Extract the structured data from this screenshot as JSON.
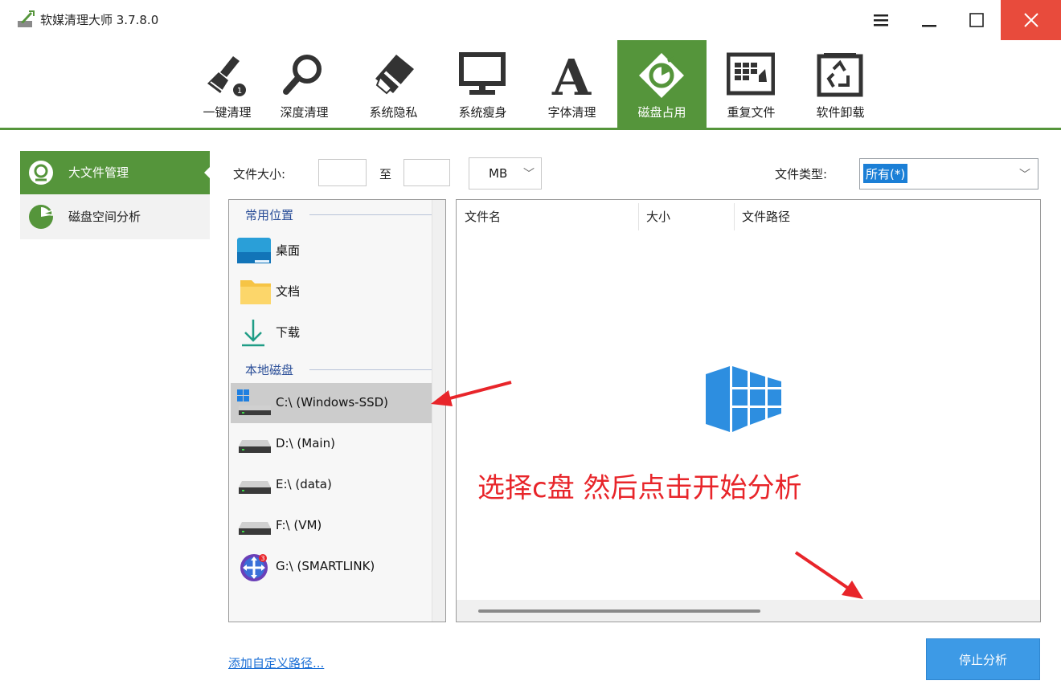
{
  "window": {
    "title": "软媒清理大师 3.7.8.0",
    "buttons": [
      "menu-icon",
      "minimize-icon",
      "maximize-icon",
      "close-icon"
    ],
    "accent_color": "#55953b",
    "close_color": "#e84b3c"
  },
  "toolbar": {
    "items": [
      {
        "label": "一键清理",
        "icon": "broom-icon"
      },
      {
        "label": "深度清理",
        "icon": "magnifier-icon"
      },
      {
        "label": "系统隐私",
        "icon": "eraser-icon"
      },
      {
        "label": "系统瘦身",
        "icon": "monitor-icon"
      },
      {
        "label": "字体清理",
        "icon": "font-a-icon"
      },
      {
        "label": "磁盘占用",
        "icon": "disk-pie-icon",
        "active": true
      },
      {
        "label": "重复文件",
        "icon": "duplicate-files-icon"
      },
      {
        "label": "软件卸载",
        "icon": "recycle-icon"
      }
    ]
  },
  "sidebar": {
    "items": [
      {
        "label": "大文件管理",
        "icon": "large-file-icon",
        "active": true
      },
      {
        "label": "磁盘空间分析",
        "icon": "pie-chart-icon"
      }
    ]
  },
  "filter": {
    "size_label": "文件大小:",
    "size_from": "",
    "to_label": "至",
    "size_to": "",
    "unit": "MB",
    "type_label": "文件类型:",
    "type_value": "所有(*)"
  },
  "tree": {
    "common_header": "常用位置",
    "common": [
      {
        "label": "桌面",
        "icon": "desktop-icon"
      },
      {
        "label": "文档",
        "icon": "folder-icon"
      },
      {
        "label": "下载",
        "icon": "download-icon"
      }
    ],
    "local_header": "本地磁盘",
    "drives": [
      {
        "label": "C:\\ (Windows-SSD)",
        "icon": "system-drive-icon",
        "selected": true
      },
      {
        "label": "D:\\ (Main)",
        "icon": "drive-icon"
      },
      {
        "label": "E:\\ (data)",
        "icon": "drive-icon"
      },
      {
        "label": "F:\\ (VM)",
        "icon": "drive-icon"
      },
      {
        "label": "G:\\ (SMARTLINK)",
        "icon": "smartlink-drive-icon"
      }
    ]
  },
  "filelist": {
    "columns": [
      "文件名",
      "大小",
      "文件路径"
    ],
    "rows": []
  },
  "annotation": {
    "text": "选择c盘 然后点击开始分析",
    "color": "#e8252a"
  },
  "footer": {
    "add_path_link": "添加自定义路径...",
    "stop_button": "停止分析"
  }
}
